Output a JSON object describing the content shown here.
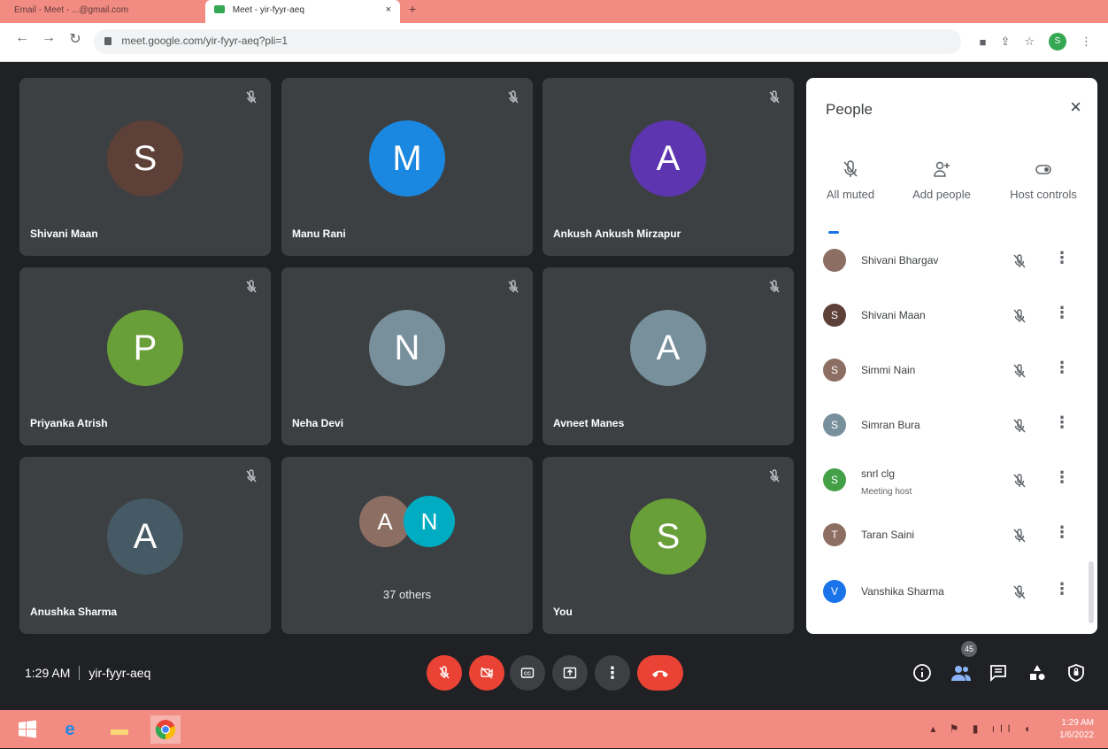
{
  "browser": {
    "tabs": [
      {
        "label": "Email - Meet - ...@gmail.com"
      },
      {
        "label": "Meet - yir-fyyr-aeq"
      }
    ],
    "url": "meet.google.com/yir-fyyr-aeq?pli=1",
    "profile_initial": "S"
  },
  "tiles": [
    {
      "initial": "S",
      "name": "Shivani Maan",
      "color": "#5d4037"
    },
    {
      "initial": "M",
      "name": "Manu Rani",
      "color": "#1a88e0"
    },
    {
      "initial": "A",
      "name": "Ankush Ankush Mirzapur",
      "color": "#5e35b1"
    },
    {
      "initial": "P",
      "name": "Priyanka Atrish",
      "color": "#689f38"
    },
    {
      "initial": "N",
      "name": "Neha Devi",
      "color": "#78909c"
    },
    {
      "initial": "A",
      "name": "Avneet Manes",
      "color": "#78909c"
    },
    {
      "initial": "A",
      "name": "Anushka Sharma",
      "color": "#455a64"
    },
    {
      "others_initials": [
        "A",
        "N"
      ],
      "others_label": "37 others"
    },
    {
      "initial": "S",
      "name": "You",
      "color": "#689f38"
    }
  ],
  "people_panel": {
    "title": "People",
    "actions": [
      "All muted",
      "Add people",
      "Host controls"
    ],
    "participants": [
      {
        "initial": "",
        "name": "Shivani Bhargav",
        "sub": "",
        "color": "#8d6e63"
      },
      {
        "initial": "S",
        "name": "Shivani Maan",
        "sub": "",
        "color": "#5d4037"
      },
      {
        "initial": "S",
        "name": "Simmi Nain",
        "sub": "",
        "color": "#8d6e63"
      },
      {
        "initial": "S",
        "name": "Simran Bura",
        "sub": "",
        "color": "#78909c"
      },
      {
        "initial": "S",
        "name": "snrl clg",
        "sub": "Meeting host",
        "color": "#43a047"
      },
      {
        "initial": "T",
        "name": "Taran Saini",
        "sub": "",
        "color": "#8d6e63"
      },
      {
        "initial": "V",
        "name": "Vanshika Sharma",
        "sub": "",
        "color": "#1a73e8"
      }
    ]
  },
  "bottom_bar": {
    "time": "1:29 AM",
    "meeting_code": "yir-fyyr-aeq",
    "participant_count": "45"
  },
  "taskbar": {
    "clock_time": "1:29 AM",
    "clock_date": "1/6/2022"
  }
}
